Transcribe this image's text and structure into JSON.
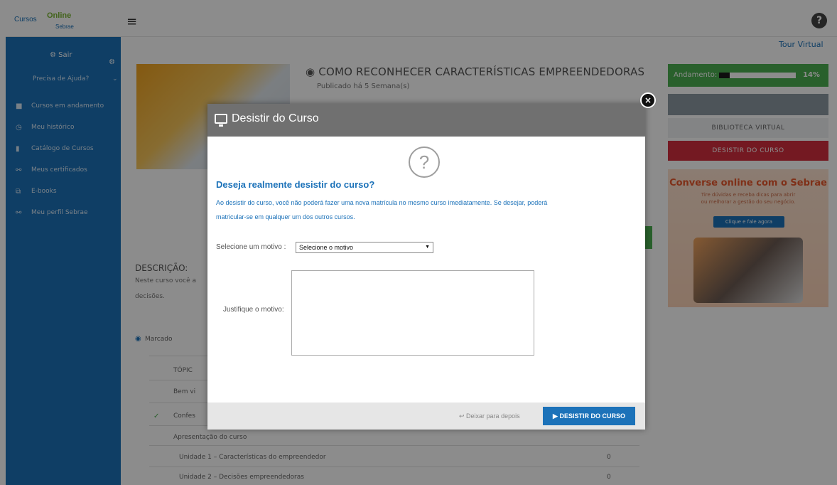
{
  "topbar": {
    "logo_text1": "Cursos",
    "logo_text2": "Online",
    "logo_text3": "Sebrae",
    "help_icon": "?"
  },
  "sidebar": {
    "sair": "⚙ Sair",
    "precisa_ajuda": "Precisa de Ajuda?",
    "items": [
      {
        "label": "Cursos em andamento",
        "icon": "book-icon"
      },
      {
        "label": "Meu histórico",
        "icon": "clock-icon"
      },
      {
        "label": "Catálogo de Cursos",
        "icon": "bookmark-icon"
      },
      {
        "label": "Meus certificados",
        "icon": "certificate-icon"
      },
      {
        "label": "E-books",
        "icon": "ebook-icon"
      },
      {
        "label": "Meu perfil Sebrae",
        "icon": "profile-icon"
      }
    ]
  },
  "main": {
    "tour_virtual": "Tour Virtual",
    "course_title": "COMO RECONHECER CARACTERÍSTICAS EMPREENDEDORAS",
    "published": "Publicado há 5 Semana(s)",
    "descricao_label": "DESCRIÇÃO:",
    "desc_text1": "Neste curso você a",
    "desc_text2": "decisões.",
    "marcado": "Marcado",
    "topico": "TÓPIC",
    "row1": "Bem vi",
    "row2": "Confes",
    "row3": "Apresentação do curso",
    "row4": "Unidade 1 – Características do empreendedor",
    "row4_num": "0",
    "row5": "Unidade 2 – Decisões empreendedoras",
    "row5_num": "0"
  },
  "right": {
    "progress_label": "Andamento:",
    "progress_value": 14,
    "progress_pct": "14%",
    "biblioteca": "BIBLIOTECA VIRTUAL",
    "desistir": "DESISTIR DO CURSO",
    "banner_title": "Converse online com o Sebrae",
    "banner_sub1": "Tire dúvidas e receba dicas para abrir",
    "banner_sub2": "ou melhorar a gestão do seu negócio.",
    "banner_button": "Clique e fale agora"
  },
  "modal": {
    "title": "Desistir do Curso",
    "close": "×",
    "question_mark": "?",
    "heading": "Deseja realmente desistir do curso?",
    "message_line1": "Ao desistir do curso, você não poderá fazer uma nova matrícula no mesmo curso imediatamente. Se desejar, poderá",
    "message_line2": "matricular-se em qualquer um dos outros cursos.",
    "reason_label": "Selecione um motivo :",
    "reason_selected": "Selecione o motivo",
    "justify_label": "Justifique o motivo:",
    "justify_value": "",
    "later_button": "↩ Deixar para depois",
    "confirm_button": "▶ DESISTIR DO CURSO"
  },
  "colors": {
    "primary": "#1c72b9",
    "success": "#4caf50",
    "danger": "#d32f3e"
  }
}
